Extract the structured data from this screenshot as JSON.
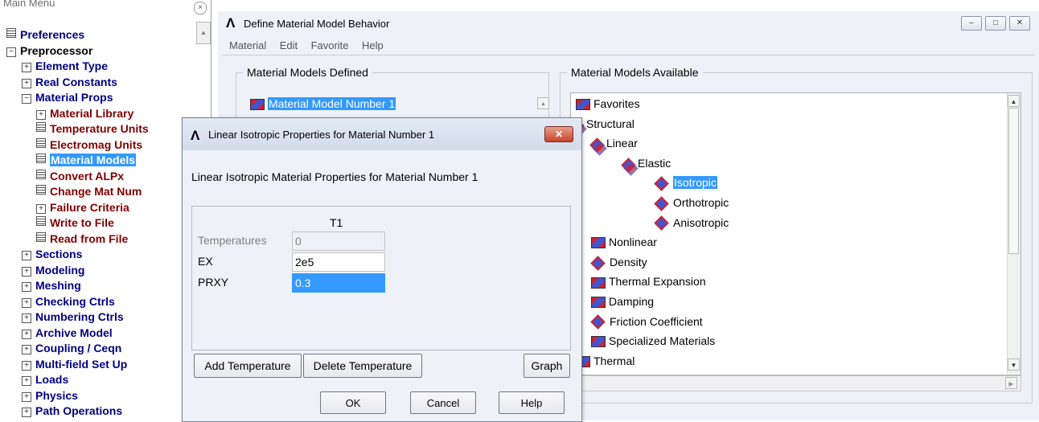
{
  "main_menu": {
    "title": "Main Menu",
    "close_glyph": "×",
    "scroll_up_glyph": "▲",
    "items": [
      {
        "label": "Preferences",
        "icon": "doc",
        "color": "#000080"
      },
      {
        "label": "Preprocessor",
        "icon": "minus",
        "color": "#000000"
      },
      {
        "label": "Element Type",
        "icon": "plus",
        "color": "#000080"
      },
      {
        "label": "Real Constants",
        "icon": "plus",
        "color": "#000080"
      },
      {
        "label": "Material Props",
        "icon": "minus",
        "color": "#000080"
      },
      {
        "label": "Material Library",
        "icon": "plus",
        "color": "#800000"
      },
      {
        "label": "Temperature Units",
        "icon": "doc",
        "color": "#800000"
      },
      {
        "label": "Electromag Units",
        "icon": "doc",
        "color": "#800000"
      },
      {
        "label": "Material Models",
        "icon": "doc",
        "color": "#800000",
        "selected": true
      },
      {
        "label": "Convert ALPx",
        "icon": "doc",
        "color": "#800000"
      },
      {
        "label": "Change Mat Num",
        "icon": "doc",
        "color": "#800000"
      },
      {
        "label": "Failure Criteria",
        "icon": "plus",
        "color": "#800000"
      },
      {
        "label": "Write to File",
        "icon": "doc",
        "color": "#800000"
      },
      {
        "label": "Read from File",
        "icon": "doc",
        "color": "#800000"
      },
      {
        "label": "Sections",
        "icon": "plus",
        "color": "#000080"
      },
      {
        "label": "Modeling",
        "icon": "plus",
        "color": "#000080"
      },
      {
        "label": "Meshing",
        "icon": "plus",
        "color": "#000080"
      },
      {
        "label": "Checking Ctrls",
        "icon": "plus",
        "color": "#000080"
      },
      {
        "label": "Numbering Ctrls",
        "icon": "plus",
        "color": "#000080"
      },
      {
        "label": "Archive Model",
        "icon": "plus",
        "color": "#000080"
      },
      {
        "label": "Coupling / Ceqn",
        "icon": "plus",
        "color": "#000080"
      },
      {
        "label": "Multi-field Set Up",
        "icon": "plus",
        "color": "#000080"
      },
      {
        "label": "Loads",
        "icon": "plus",
        "color": "#000080"
      },
      {
        "label": "Physics",
        "icon": "plus",
        "color": "#000080"
      },
      {
        "label": "Path Operations",
        "icon": "plus",
        "color": "#000080"
      }
    ]
  },
  "main_window": {
    "logo": "Λ",
    "title": "Define Material Model Behavior",
    "controls": {
      "minimize": "–",
      "maximize": "□",
      "close": "✕"
    },
    "menu": [
      "Material",
      "Edit",
      "Favorite",
      "Help"
    ],
    "defined_group": {
      "label": "Material Models Defined",
      "items": [
        "Material Model Number 1"
      ],
      "scroll_glyph": "▲"
    },
    "available_group": {
      "label": "Material Models Available",
      "scroll_up_glyph": "▲",
      "scroll_down_glyph": "▼",
      "hscroll_glyph": "▶",
      "tree": [
        {
          "label": "Favorites",
          "icon": "folder"
        },
        {
          "label": "Structural",
          "icon": "stack"
        },
        {
          "label": "Linear",
          "icon": "stack"
        },
        {
          "label": "Elastic",
          "icon": "stack"
        },
        {
          "label": "Isotropic",
          "icon": "diamond",
          "selected": true
        },
        {
          "label": "Orthotropic",
          "icon": "diamond"
        },
        {
          "label": "Anisotropic",
          "icon": "diamond"
        },
        {
          "label": "Nonlinear",
          "icon": "folder"
        },
        {
          "label": "Density",
          "icon": "diamond"
        },
        {
          "label": "Thermal Expansion",
          "icon": "folder"
        },
        {
          "label": "Damping",
          "icon": "folder"
        },
        {
          "label": "Friction Coefficient",
          "icon": "diamond"
        },
        {
          "label": "Specialized Materials",
          "icon": "folder"
        },
        {
          "label": "Thermal",
          "icon": "folder"
        }
      ]
    }
  },
  "dialog": {
    "logo": "Λ",
    "title": "Linear Isotropic Properties for Material Number 1",
    "close_glyph": "✕",
    "heading": "Linear Isotropic Material Properties for Material Number 1",
    "column_header": "T1",
    "rows": [
      {
        "label": "Temperatures",
        "value": "0",
        "disabled": true
      },
      {
        "label": "EX",
        "value": "2e5"
      },
      {
        "label": "PRXY",
        "value": "0.3",
        "highlighted": true
      }
    ],
    "buttons": {
      "add_temperature": "Add Temperature",
      "delete_temperature": "Delete Temperature",
      "graph": "Graph",
      "ok": "OK",
      "cancel": "Cancel",
      "help": "Help"
    }
  }
}
